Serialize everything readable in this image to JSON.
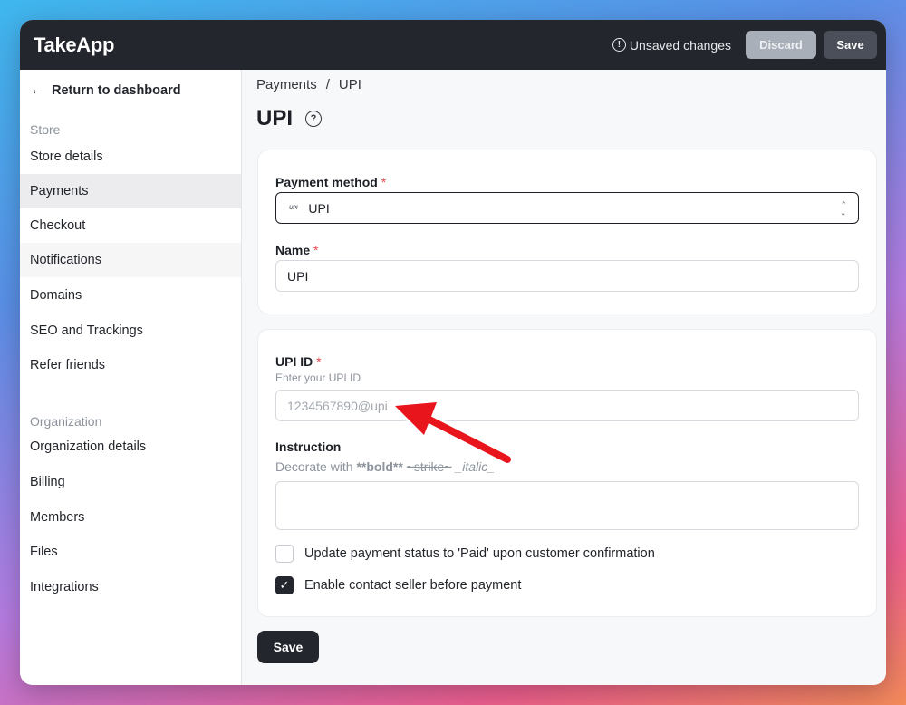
{
  "app": {
    "logo": "TakeApp",
    "unsaved_text": "Unsaved changes",
    "discard_label": "Discard",
    "save_label": "Save"
  },
  "sidebar": {
    "back_label": "Return to dashboard",
    "store_section": "Store",
    "store_items": [
      "Store details",
      "Payments",
      "Checkout",
      "Notifications",
      "Domains",
      "SEO and Trackings",
      "Refer friends"
    ],
    "active_item": "Payments",
    "org_section": "Organization",
    "org_items": [
      "Organization details",
      "Billing",
      "Members",
      "Files",
      "Integrations"
    ]
  },
  "breadcrumb": {
    "parent": "Payments",
    "separator": "/",
    "current": "UPI"
  },
  "page": {
    "title": "UPI"
  },
  "method_card": {
    "payment_method_label": "Payment method",
    "required_mark": "*",
    "payment_method_logo": "UPI",
    "payment_method_value": "UPI",
    "name_label": "Name",
    "name_value": "UPI"
  },
  "details_card": {
    "upi_label": "UPI ID",
    "upi_hint": "Enter your UPI ID",
    "upi_placeholder": "1234567890@upi",
    "instruction_label": "Instruction",
    "decorate_prefix": "Decorate with",
    "decorate_bold": "**bold**",
    "decorate_strike": "~strike~",
    "decorate_italic": "_italic_",
    "checkbox_paid_label": "Update payment status to 'Paid' upon customer confirmation",
    "checkbox_paid_checked": false,
    "checkbox_contact_label": "Enable contact seller before payment",
    "checkbox_contact_checked": true
  },
  "footer": {
    "save_label": "Save"
  },
  "colors": {
    "accent_dark": "#23262c",
    "required": "#e5484d",
    "annotation_arrow": "#e8141b"
  },
  "icons": [
    "info-icon",
    "arrow-left-icon",
    "help-icon",
    "chevron-updown-icon",
    "check-icon"
  ]
}
